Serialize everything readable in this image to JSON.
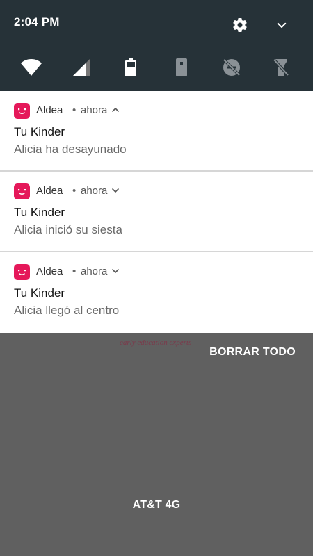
{
  "status_bar": {
    "time": "2:04 PM"
  },
  "header_icons": {
    "settings": "gear-icon",
    "collapse": "chevron-down-icon"
  },
  "quick_settings": [
    {
      "name": "wifi-icon"
    },
    {
      "name": "cellular-signal-icon"
    },
    {
      "name": "battery-icon"
    },
    {
      "name": "auto-rotate-icon"
    },
    {
      "name": "do-not-disturb-off-icon"
    },
    {
      "name": "flashlight-off-icon"
    }
  ],
  "notifications": [
    {
      "app": "Aldea",
      "separator": "•",
      "time": "ahora",
      "chevron": "chevron-up-icon",
      "title": "Tu Kinder",
      "text": "Alicia ha desayunado"
    },
    {
      "app": "Aldea",
      "separator": "•",
      "time": "ahora",
      "chevron": "chevron-down-icon",
      "title": "Tu Kinder",
      "text": "Alicia inició su siesta"
    },
    {
      "app": "Aldea",
      "separator": "•",
      "time": "ahora",
      "chevron": "chevron-down-icon",
      "title": "Tu Kinder",
      "text": "Alicia llegó al centro"
    }
  ],
  "background": {
    "tagline": "early education experts"
  },
  "clear_all_label": "BORRAR TODO",
  "carrier": "AT&T 4G",
  "colors": {
    "shade": "#263238",
    "app_accent": "#e5185a",
    "backdrop": "#606060"
  }
}
